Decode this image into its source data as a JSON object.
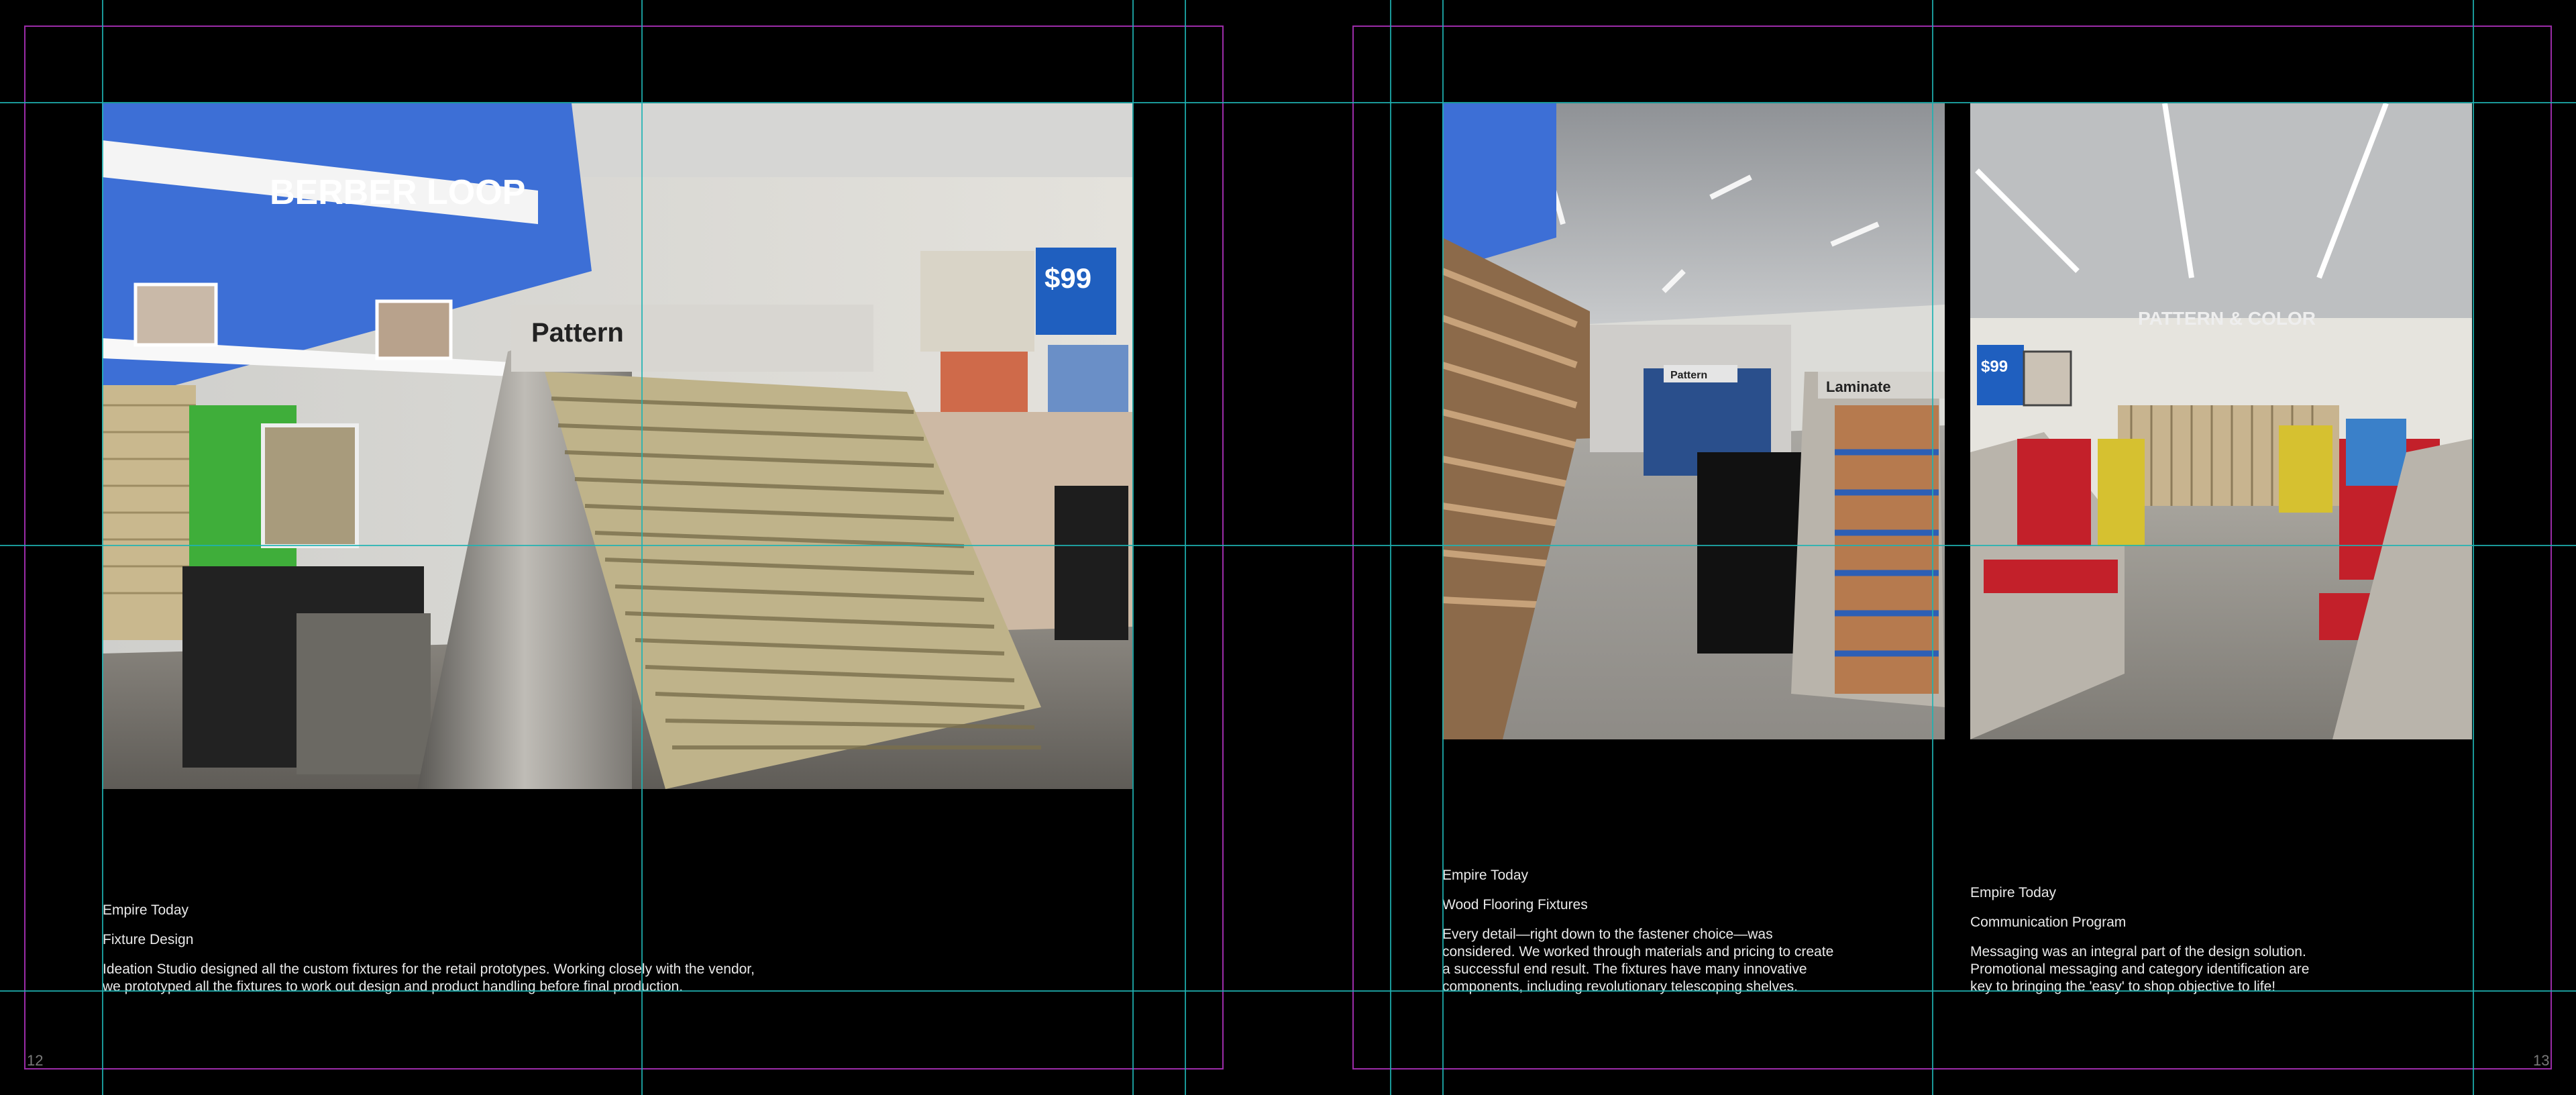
{
  "spread": {
    "left_page": {
      "folio": "12",
      "photo": {
        "name": "pattern-carpet-fixture-photo",
        "sign_text": "Pattern",
        "wall_sign_text": "BERBER LOOP",
        "price_sign_text": "$99"
      },
      "caption": {
        "client": "Empire Today",
        "project": "Fixture Design",
        "body": "Ideation Studio designed all the custom fixtures for the retail prototypes. Working closely with the vendor,\nwe prototyped all the fixtures to work out design and product handling before final production."
      }
    },
    "right_page": {
      "folio": "13",
      "photo_left": {
        "name": "wood-flooring-fixtures-photo",
        "sign_text": "Laminate",
        "sub_sign_text": "Pattern"
      },
      "photo_right": {
        "name": "communication-program-photo",
        "wall_sign_text": "PATTERN & COLOR",
        "price_sign_text": "$99"
      },
      "caption_left": {
        "client": "Empire Today",
        "project": "Wood Flooring Fixtures",
        "body": "Every detail—right down to the fastener choice—was\nconsidered. We  worked through materials and pricing to create\na successful end result. The fixtures have many innovative\ncomponents, including revolutionary telescoping shelves."
      },
      "caption_right": {
        "client": "Empire Today",
        "project": "Communication Program",
        "body": "Messaging was an integral part of the design solution.\nPromotional messaging and category identification are\nkey to bringing the 'easy' to shop objective to life!"
      }
    }
  },
  "colors": {
    "guide": "#1fb3b3",
    "margin": "#9b2ca8",
    "background": "#000000",
    "wall_blue": "#3d6fd6"
  }
}
